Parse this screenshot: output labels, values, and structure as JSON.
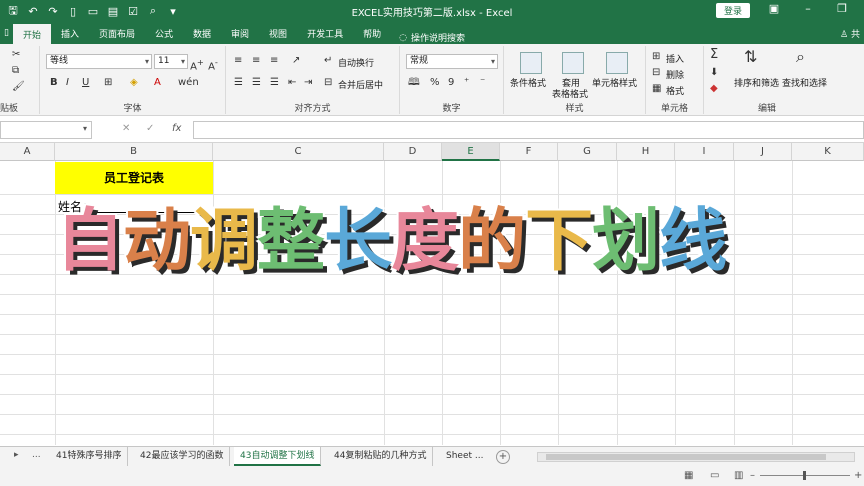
{
  "titlebar": {
    "document_title": "EXCEL实用技巧第二版.xlsx  -  Excel",
    "login_label": "登录"
  },
  "tabs": [
    "开始",
    "插入",
    "页面布局",
    "公式",
    "数据",
    "审阅",
    "视图",
    "开发工具",
    "帮助"
  ],
  "tell_me": "操作说明搜索",
  "share": "共",
  "ribbon": {
    "clipboard_label": "贴板",
    "font_name": "等线",
    "font_size": "11",
    "font_label": "字体",
    "align_label": "对齐方式",
    "wrap_text": "自动换行",
    "merge_center": "合并后居中",
    "number_format": "常规",
    "number_label": "数字",
    "cond_format": "条件格式",
    "table_format_1": "套用",
    "table_format_2": "表格格式",
    "cell_style": "单元格样式",
    "styles_label": "样式",
    "insert": "插入",
    "delete": "删除",
    "format": "格式",
    "cells_label": "单元格",
    "sort_filter": "排序和筛选",
    "find_select": "查找和选择",
    "editing_label": "编辑",
    "bold": "B",
    "italic": "I",
    "underline": "U",
    "sum": "Σ",
    "percent": "%",
    "comma": "9"
  },
  "formula_bar": {
    "fx": "fx",
    "cancel": "✕",
    "confirm": "✓"
  },
  "columns": [
    "A",
    "B",
    "C",
    "D",
    "E",
    "F",
    "G",
    "H",
    "I",
    "J",
    "K"
  ],
  "cells": {
    "b1": "员工登记表",
    "b2": "姓名："
  },
  "overlay": {
    "chars": [
      {
        "t": "自",
        "color": "#e8879a"
      },
      {
        "t": "动",
        "color": "#d9804a"
      },
      {
        "t": "调",
        "color": "#e9b94a"
      },
      {
        "t": "整",
        "color": "#6dbd72"
      },
      {
        "t": "长",
        "color": "#5aa8d8"
      },
      {
        "t": "度",
        "color": "#e8879a"
      },
      {
        "t": "的",
        "color": "#d9804a"
      },
      {
        "t": "下",
        "color": "#e9b94a"
      },
      {
        "t": "划",
        "color": "#6dbd72"
      },
      {
        "t": "线",
        "color": "#5aa8d8"
      }
    ]
  },
  "sheets": [
    "41特殊序号排序",
    "42最应该学习的函数",
    "43自动调整下划线",
    "44复制粘贴的几种方式",
    "Sheet ..."
  ],
  "active_sheet_index": 2,
  "sheet_nav": {
    "next": "▸",
    "more": "..."
  },
  "add_sheet": "+"
}
